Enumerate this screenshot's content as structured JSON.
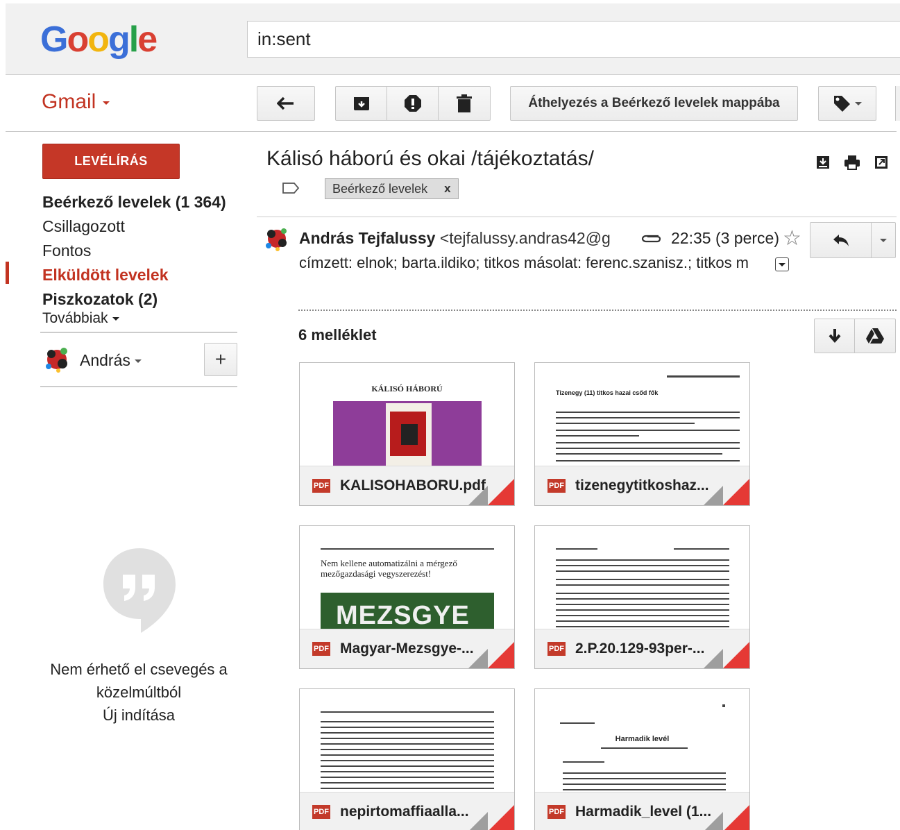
{
  "header": {
    "logo": "Google",
    "search_value": "in:sent"
  },
  "toolbar": {
    "app_label": "Gmail",
    "move_to_inbox_label": "Áthelyezés a Beérkező levelek mappába"
  },
  "sidebar": {
    "compose_label": "LEVÉLÍRÁS",
    "items": [
      {
        "label": "Beérkező levelek (1 364)",
        "style": "bold"
      },
      {
        "label": "Csillagozott",
        "style": "normal"
      },
      {
        "label": "Fontos",
        "style": "normal"
      },
      {
        "label": "Elküldött levelek",
        "style": "active"
      },
      {
        "label": "Piszkozatok (2)",
        "style": "bold"
      }
    ],
    "more_label": "Továbbiak",
    "user_name": "András",
    "chat_message_line1": "Nem érhető el csevegés a",
    "chat_message_line2": "közelmúltból",
    "chat_new_link": "Új indítása"
  },
  "message": {
    "subject": "Kálisó háború és okai /tájékoztatás/",
    "label_chip": "Beérkező levelek",
    "label_chip_remove": "x",
    "sender_name": "András Tejfalussy",
    "sender_email": "<tejfalussy.andras42@g",
    "time": "22:35 (3 perce)",
    "recipients": "címzett: elnok; barta.ildiko; titkos másolat: ferenc.szanisz.; titkos m",
    "attachments_count": "6 melléklet",
    "attachments": [
      {
        "name": "KALISOHABORU.pdf",
        "preview_title": "KÁLISÓ HÁBORÚ"
      },
      {
        "name": "tizenegytitkoshaz...",
        "preview_title": "Tizenegy (11) titkos hazai csőd fők"
      },
      {
        "name": "Magyar-Mezsgye-...",
        "preview_title": "Nem kellene automatizálni a mérgező mezőgazdasági vegyszerezést!",
        "preview_banner": "MEZSGYE"
      },
      {
        "name": "2.P.20.129-93per-..."
      },
      {
        "name": "nepirtomaffiaalla..."
      },
      {
        "name": "Harmadik_level (1...",
        "preview_title": "Harmadik levél"
      }
    ]
  },
  "colors": {
    "brand_red": "#c23321",
    "compose_bg": "#c53727",
    "pdf_red": "#c33a2a"
  }
}
